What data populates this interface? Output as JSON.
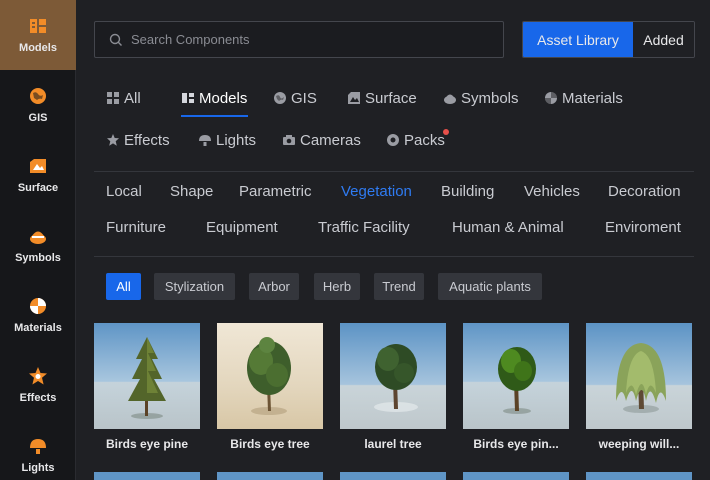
{
  "sidebar": {
    "items": [
      {
        "label": "Models",
        "icon": "models-icon",
        "active": true
      },
      {
        "label": "GIS",
        "icon": "gis-icon"
      },
      {
        "label": "Surface",
        "icon": "surface-icon"
      },
      {
        "label": "Symbols",
        "icon": "symbols-icon"
      },
      {
        "label": "Materials",
        "icon": "materials-icon"
      },
      {
        "label": "Effects",
        "icon": "effects-icon"
      },
      {
        "label": "Lights",
        "icon": "lights-icon"
      }
    ]
  },
  "search": {
    "placeholder": "Search Components",
    "value": ""
  },
  "library_toggle": {
    "asset_library": "Asset Library",
    "added": "Added",
    "active": "asset_library"
  },
  "category_tabs": {
    "items": [
      "All",
      "Models",
      "GIS",
      "Surface",
      "Symbols",
      "Materials",
      "Effects",
      "Lights",
      "Cameras",
      "Packs"
    ],
    "active": "Models"
  },
  "sub_categories": {
    "items": [
      "Local",
      "Shape",
      "Parametric",
      "Vegetation",
      "Building",
      "Vehicles",
      "Decoration",
      "Furniture",
      "Equipment",
      "Traffic Facility",
      "Human & Animal",
      "Enviroment"
    ],
    "active": "Vegetation"
  },
  "filter_chips": {
    "items": [
      "All",
      "Stylization",
      "Arbor",
      "Herb",
      "Trend",
      "Aquatic plants"
    ],
    "active": "All"
  },
  "assets": [
    {
      "name": "Birds eye pine"
    },
    {
      "name": "Birds eye tree"
    },
    {
      "name": "laurel tree"
    },
    {
      "name": "Birds eye pin..."
    },
    {
      "name": "weeping will..."
    }
  ],
  "colors": {
    "accent": "#1867ea",
    "active_sidebar": "#7d5a37",
    "icon_orange": "#f28c28",
    "badge": "#e8504a"
  }
}
